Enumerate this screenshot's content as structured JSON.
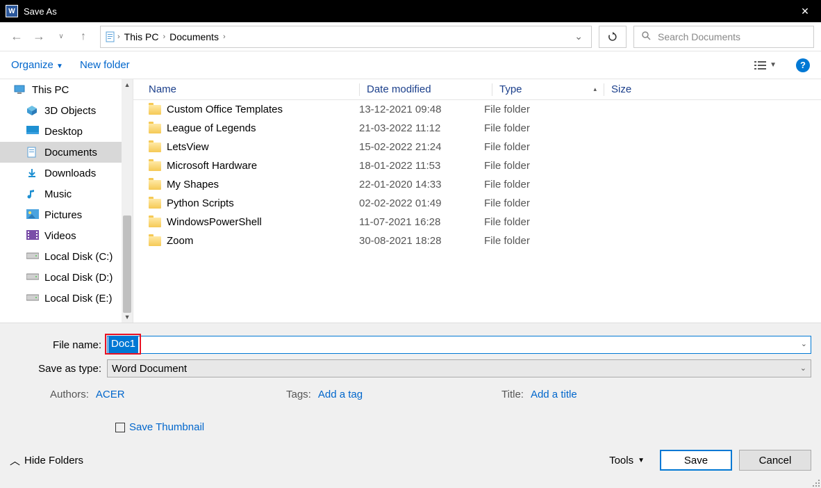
{
  "title": "Save As",
  "breadcrumb": {
    "root": "This PC",
    "folder": "Documents"
  },
  "search": {
    "placeholder": "Search Documents"
  },
  "toolbar": {
    "organize": "Organize",
    "new_folder": "New folder"
  },
  "tree": {
    "items": [
      {
        "label": "This PC"
      },
      {
        "label": "3D Objects"
      },
      {
        "label": "Desktop"
      },
      {
        "label": "Documents"
      },
      {
        "label": "Downloads"
      },
      {
        "label": "Music"
      },
      {
        "label": "Pictures"
      },
      {
        "label": "Videos"
      },
      {
        "label": "Local Disk (C:)"
      },
      {
        "label": "Local Disk (D:)"
      },
      {
        "label": "Local Disk (E:)"
      }
    ]
  },
  "columns": {
    "name": "Name",
    "date": "Date modified",
    "type": "Type",
    "size": "Size"
  },
  "files": [
    {
      "name": "Custom Office Templates",
      "date": "13-12-2021 09:48",
      "type": "File folder"
    },
    {
      "name": "League of Legends",
      "date": "21-03-2022 11:12",
      "type": "File folder"
    },
    {
      "name": "LetsView",
      "date": "15-02-2022 21:24",
      "type": "File folder"
    },
    {
      "name": "Microsoft Hardware",
      "date": "18-01-2022 11:53",
      "type": "File folder"
    },
    {
      "name": "My Shapes",
      "date": "22-01-2020 14:33",
      "type": "File folder"
    },
    {
      "name": "Python Scripts",
      "date": "02-02-2022 01:49",
      "type": "File folder"
    },
    {
      "name": "WindowsPowerShell",
      "date": "11-07-2021 16:28",
      "type": "File folder"
    },
    {
      "name": "Zoom",
      "date": "30-08-2021 18:28",
      "type": "File folder"
    }
  ],
  "fields": {
    "filename_label": "File name:",
    "filename_value": "Doc1",
    "type_label": "Save as type:",
    "type_value": "Word Document"
  },
  "meta": {
    "authors_label": "Authors:",
    "authors_value": "ACER",
    "tags_label": "Tags:",
    "tags_value": "Add a tag",
    "title_label": "Title:",
    "title_value": "Add a title"
  },
  "thumb": {
    "label": "Save Thumbnail"
  },
  "actions": {
    "hide_folders": "Hide Folders",
    "tools": "Tools",
    "save": "Save",
    "cancel": "Cancel"
  }
}
